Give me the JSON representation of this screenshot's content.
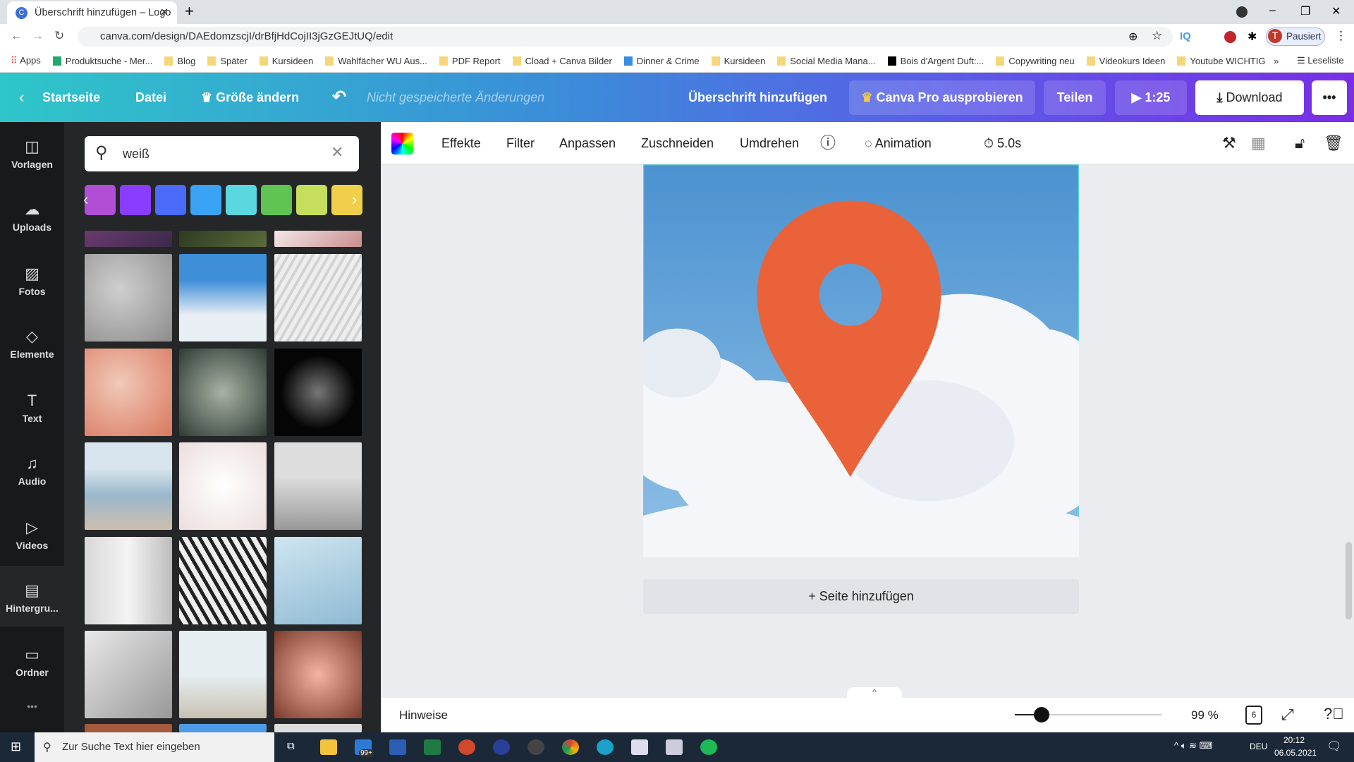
{
  "browser": {
    "tab_title": "Überschrift hinzufügen – Logo",
    "url": "canva.com/design/DAEdomzscjI/drBfjHdCojII3jGzGEJtUQ/edit",
    "profile_label": "Pausiert",
    "profile_initial": "T",
    "bookmarks": [
      "Apps",
      "Produktsuche - Mer...",
      "Blog",
      "Später",
      "Kursideen",
      "Wahlfächer WU Aus...",
      "PDF Report",
      "Cload + Canva Bilder",
      "Dinner & Crime",
      "Kursideen",
      "Social Media Mana...",
      "Bois d'Argent Duft:...",
      "Copywriting neu",
      "Videokurs Ideen",
      "Youtube WICHTIG"
    ],
    "reading_list": "Leseliste"
  },
  "header": {
    "home": "Startseite",
    "file": "Datei",
    "resize": "Größe ändern",
    "save_status": "Nicht gespeicherte Änderungen",
    "title": "Überschrift hinzufügen",
    "pro": "Canva Pro ausprobieren",
    "share": "Teilen",
    "play_time": "1:25",
    "download": "Download"
  },
  "nav": [
    {
      "label": "Vorlagen",
      "icon": "template-icon"
    },
    {
      "label": "Uploads",
      "icon": "upload-icon"
    },
    {
      "label": "Fotos",
      "icon": "photo-icon"
    },
    {
      "label": "Elemente",
      "icon": "elements-icon"
    },
    {
      "label": "Text",
      "icon": "text-icon"
    },
    {
      "label": "Audio",
      "icon": "audio-icon"
    },
    {
      "label": "Videos",
      "icon": "video-icon"
    },
    {
      "label": "Hintergru...",
      "icon": "background-icon"
    },
    {
      "label": "Ordner",
      "icon": "folder-icon"
    }
  ],
  "panel": {
    "search_value": "weiß",
    "swatches": [
      "#b04fd6",
      "#8b3dff",
      "#4b6bfb",
      "#3aa3f6",
      "#5ad8e0",
      "#5fc451",
      "#c5de5c",
      "#f0d04a"
    ]
  },
  "toolbar": {
    "items": [
      "Effekte",
      "Filter",
      "Anpassen",
      "Zuschneiden",
      "Umdrehen"
    ],
    "animation": "Animation",
    "duration": "5.0s"
  },
  "canvas": {
    "add_page": "+ Seite hinzufügen",
    "pin_color": "#ea623a"
  },
  "bottom": {
    "notes": "Hinweise",
    "zoom": "99 %",
    "zoom_percent": 99,
    "pages": "6"
  },
  "taskbar": {
    "search_placeholder": "Zur Suche Text hier eingeben",
    "badge": "99+",
    "lang": "DEU",
    "time": "20:12",
    "date": "06.05.2021"
  }
}
